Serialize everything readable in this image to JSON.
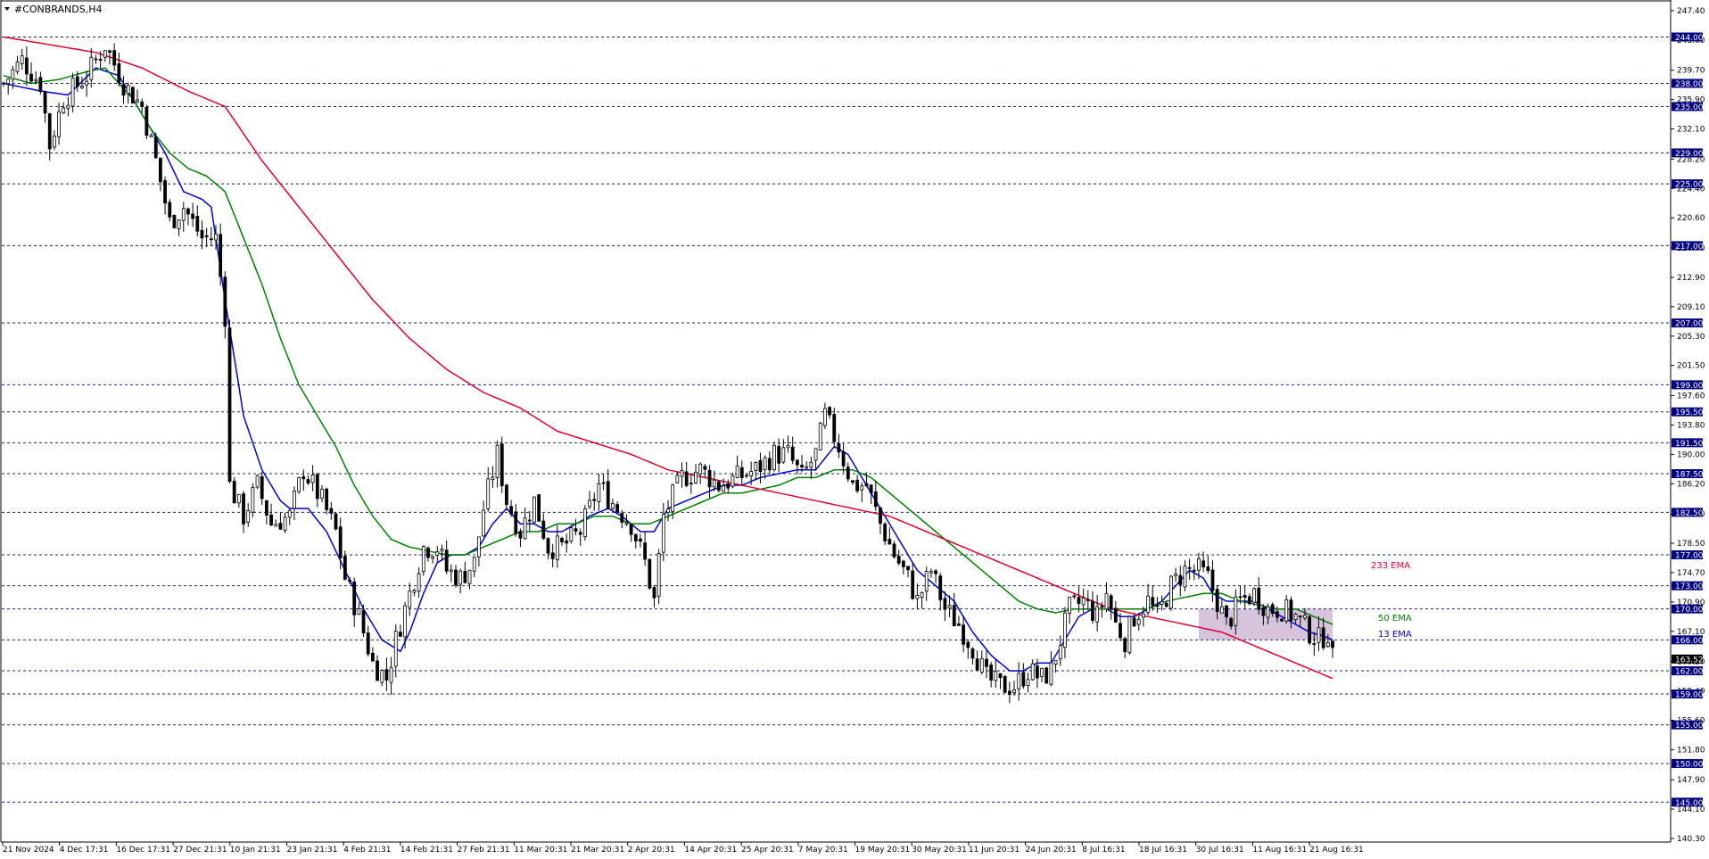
{
  "chart_data": {
    "type": "candlestick",
    "title": "#CONBRANDS,H4",
    "y_ticks": [
      "247.40",
      "243.60",
      "239.70",
      "235.90",
      "232.10",
      "228.20",
      "224.40",
      "220.60",
      "216.70",
      "212.90",
      "209.10",
      "205.30",
      "201.50",
      "197.60",
      "193.80",
      "190.00",
      "186.20",
      "182.30",
      "178.50",
      "174.70",
      "170.90",
      "167.10",
      "163.20",
      "159.40",
      "155.60",
      "151.80",
      "147.90",
      "144.10",
      "140.30"
    ],
    "ylim": [
      140.3,
      247.4
    ],
    "x_tick_labels": [
      "21 Nov 2024",
      "4 Dec 17:31",
      "16 Dec 17:31",
      "27 Dec 21:31",
      "10 Jan 21:31",
      "23 Jan 21:31",
      "4 Feb 21:31",
      "14 Feb 21:31",
      "27 Feb 21:31",
      "11 Mar 20:31",
      "21 Mar 20:31",
      "2 Apr 20:31",
      "14 Apr 20:31",
      "25 Apr 20:31",
      "7 May 20:31",
      "19 May 20:31",
      "30 May 20:31",
      "11 Jun 20:31",
      "24 Jun 20:31",
      "8 Jul 16:31",
      "18 Jul 16:31",
      "30 Jul 16:31",
      "11 Aug 16:31",
      "21 Aug 16:31"
    ],
    "horizontal_levels": [
      "244.00",
      "238.00",
      "235.00",
      "229.00",
      "225.00",
      "217.00",
      "207.00",
      "199.00",
      "195.50",
      "191.50",
      "187.50",
      "182.50",
      "177.00",
      "173.00",
      "170.00",
      "166.00",
      "162.00",
      "159.00",
      "155.00",
      "150.00",
      "145.00"
    ],
    "current_price": "163.52",
    "price_path": [
      [
        0,
        238
      ],
      [
        4,
        241
      ],
      [
        8,
        238
      ],
      [
        10,
        230
      ],
      [
        13,
        236
      ],
      [
        18,
        239
      ],
      [
        22,
        243
      ],
      [
        26,
        238
      ],
      [
        30,
        235
      ],
      [
        33,
        228
      ],
      [
        36,
        220
      ],
      [
        39,
        222
      ],
      [
        43,
        218
      ],
      [
        46,
        218
      ],
      [
        48,
        208
      ],
      [
        49,
        186
      ],
      [
        52,
        182
      ],
      [
        55,
        186
      ],
      [
        58,
        181
      ],
      [
        62,
        182
      ],
      [
        65,
        188
      ],
      [
        69,
        184
      ],
      [
        72,
        180
      ],
      [
        74,
        174
      ],
      [
        77,
        169
      ],
      [
        80,
        163
      ],
      [
        83,
        161
      ],
      [
        85,
        166
      ],
      [
        88,
        172
      ],
      [
        91,
        178
      ],
      [
        94,
        178
      ],
      [
        96,
        175
      ],
      [
        99,
        174
      ],
      [
        102,
        176
      ],
      [
        104,
        183
      ],
      [
        107,
        190
      ],
      [
        109,
        184
      ],
      [
        112,
        180
      ],
      [
        115,
        184
      ],
      [
        118,
        178
      ],
      [
        121,
        178
      ],
      [
        125,
        180
      ],
      [
        129,
        186
      ],
      [
        133,
        183
      ],
      [
        136,
        181
      ],
      [
        139,
        176
      ],
      [
        141,
        171
      ],
      [
        143,
        182
      ],
      [
        147,
        187
      ],
      [
        151,
        188
      ],
      [
        155,
        186
      ],
      [
        159,
        187
      ],
      [
        163,
        188
      ],
      [
        167,
        190
      ],
      [
        170,
        190
      ],
      [
        173,
        187
      ],
      [
        176,
        190
      ],
      [
        178,
        195
      ],
      [
        181,
        191
      ],
      [
        184,
        186
      ],
      [
        187,
        186
      ],
      [
        190,
        181
      ],
      [
        193,
        177
      ],
      [
        196,
        174
      ],
      [
        198,
        171
      ],
      [
        201,
        175
      ],
      [
        204,
        170
      ],
      [
        207,
        168
      ],
      [
        210,
        165
      ],
      [
        213,
        161
      ],
      [
        216,
        160
      ],
      [
        219,
        160
      ],
      [
        222,
        162
      ],
      [
        225,
        161
      ],
      [
        227,
        162
      ],
      [
        229,
        166
      ],
      [
        231,
        170
      ],
      [
        234,
        171
      ],
      [
        237,
        169
      ],
      [
        239,
        172
      ],
      [
        241,
        168
      ],
      [
        243,
        166
      ],
      [
        245,
        169
      ],
      [
        248,
        171
      ],
      [
        250,
        169
      ],
      [
        253,
        173
      ],
      [
        256,
        175
      ],
      [
        259,
        175
      ],
      [
        261,
        174
      ],
      [
        263,
        171
      ],
      [
        265,
        168
      ],
      [
        268,
        171
      ],
      [
        271,
        172
      ],
      [
        274,
        170
      ],
      [
        277,
        170
      ],
      [
        280,
        169
      ],
      [
        283,
        167
      ],
      [
        285,
        166
      ],
      [
        287,
        167
      ],
      [
        288,
        163.5
      ]
    ],
    "ema_values": [
      {
        "name": "13 EMA",
        "color": "#0000cc",
        "values": [
          [
            0,
            238
          ],
          [
            8,
            237
          ],
          [
            14,
            236.5
          ],
          [
            20,
            240
          ],
          [
            25,
            239
          ],
          [
            30,
            234
          ],
          [
            35,
            229
          ],
          [
            39,
            224
          ],
          [
            43,
            223
          ],
          [
            45,
            222
          ],
          [
            48,
            210
          ],
          [
            52,
            195
          ],
          [
            56,
            188
          ],
          [
            60,
            184
          ],
          [
            62,
            183
          ],
          [
            66,
            183
          ],
          [
            70,
            180
          ],
          [
            74,
            175
          ],
          [
            78,
            170
          ],
          [
            82,
            166
          ],
          [
            86,
            164.5
          ],
          [
            88,
            167
          ],
          [
            91,
            172
          ],
          [
            94,
            176
          ],
          [
            97,
            177
          ],
          [
            100,
            177
          ],
          [
            103,
            178
          ],
          [
            106,
            181
          ],
          [
            109,
            183
          ],
          [
            112,
            181
          ],
          [
            115,
            181
          ],
          [
            118,
            180
          ],
          [
            121,
            180
          ],
          [
            124,
            181
          ],
          [
            127,
            182
          ],
          [
            131,
            183
          ],
          [
            134,
            182
          ],
          [
            138,
            180
          ],
          [
            141,
            180
          ],
          [
            144,
            183
          ],
          [
            148,
            184
          ],
          [
            152,
            185
          ],
          [
            156,
            186
          ],
          [
            160,
            186
          ],
          [
            164,
            187
          ],
          [
            168,
            187.5
          ],
          [
            172,
            188
          ],
          [
            176,
            188
          ],
          [
            180,
            191
          ],
          [
            183,
            190
          ],
          [
            186,
            187
          ],
          [
            189,
            184
          ],
          [
            192,
            181
          ],
          [
            195,
            178
          ],
          [
            198,
            175
          ],
          [
            202,
            173
          ],
          [
            206,
            171
          ],
          [
            210,
            167
          ],
          [
            214,
            164
          ],
          [
            218,
            162
          ],
          [
            221,
            162
          ],
          [
            224,
            163
          ],
          [
            227,
            163
          ],
          [
            230,
            166
          ],
          [
            233,
            169
          ],
          [
            236,
            170
          ],
          [
            239,
            170
          ],
          [
            242,
            169
          ],
          [
            245,
            169
          ],
          [
            248,
            170
          ],
          [
            251,
            171
          ],
          [
            254,
            173
          ],
          [
            257,
            175
          ],
          [
            260,
            174
          ],
          [
            262,
            172
          ],
          [
            265,
            171
          ],
          [
            268,
            171
          ],
          [
            271,
            171
          ],
          [
            274,
            170
          ],
          [
            277,
            169
          ],
          [
            280,
            168
          ],
          [
            283,
            167
          ],
          [
            286,
            166.5
          ],
          [
            288,
            166
          ]
        ]
      },
      {
        "name": "50 EMA",
        "color": "#008000",
        "values": [
          [
            0,
            239
          ],
          [
            6,
            238
          ],
          [
            12,
            238.5
          ],
          [
            18,
            239.5
          ],
          [
            22,
            240
          ],
          [
            25,
            238
          ],
          [
            28,
            236
          ],
          [
            32,
            232
          ],
          [
            36,
            229
          ],
          [
            40,
            227
          ],
          [
            44,
            226
          ],
          [
            48,
            224
          ],
          [
            52,
            218
          ],
          [
            56,
            212
          ],
          [
            60,
            205
          ],
          [
            64,
            199
          ],
          [
            68,
            195
          ],
          [
            72,
            191
          ],
          [
            76,
            186
          ],
          [
            80,
            182
          ],
          [
            84,
            179
          ],
          [
            88,
            178
          ],
          [
            92,
            177.5
          ],
          [
            96,
            177
          ],
          [
            100,
            177
          ],
          [
            104,
            178
          ],
          [
            108,
            179
          ],
          [
            112,
            180
          ],
          [
            116,
            180
          ],
          [
            120,
            181
          ],
          [
            124,
            181
          ],
          [
            128,
            182
          ],
          [
            132,
            182
          ],
          [
            136,
            181
          ],
          [
            140,
            181
          ],
          [
            144,
            182
          ],
          [
            148,
            183
          ],
          [
            152,
            184
          ],
          [
            156,
            185
          ],
          [
            160,
            185
          ],
          [
            164,
            185.5
          ],
          [
            168,
            186
          ],
          [
            172,
            187
          ],
          [
            176,
            187
          ],
          [
            180,
            188
          ],
          [
            184,
            188
          ],
          [
            188,
            187
          ],
          [
            192,
            185
          ],
          [
            196,
            183
          ],
          [
            200,
            181
          ],
          [
            204,
            179
          ],
          [
            208,
            177
          ],
          [
            212,
            175
          ],
          [
            216,
            173
          ],
          [
            220,
            171
          ],
          [
            224,
            170
          ],
          [
            228,
            169.5
          ],
          [
            232,
            170
          ],
          [
            236,
            170
          ],
          [
            240,
            170
          ],
          [
            244,
            170
          ],
          [
            248,
            170
          ],
          [
            252,
            171
          ],
          [
            256,
            171.5
          ],
          [
            260,
            172
          ],
          [
            264,
            172
          ],
          [
            268,
            171
          ],
          [
            272,
            170.5
          ],
          [
            276,
            170
          ],
          [
            280,
            170
          ],
          [
            284,
            169
          ],
          [
            288,
            168
          ]
        ]
      },
      {
        "name": "233 EMA",
        "color": "#dd0033",
        "values": [
          [
            0,
            244
          ],
          [
            10,
            243
          ],
          [
            20,
            242
          ],
          [
            30,
            240
          ],
          [
            40,
            237
          ],
          [
            48,
            235
          ],
          [
            56,
            228
          ],
          [
            64,
            222
          ],
          [
            72,
            216
          ],
          [
            80,
            210
          ],
          [
            88,
            205
          ],
          [
            96,
            201
          ],
          [
            104,
            198
          ],
          [
            112,
            196
          ],
          [
            120,
            193
          ],
          [
            128,
            191.5
          ],
          [
            136,
            190
          ],
          [
            144,
            188
          ],
          [
            152,
            187
          ],
          [
            160,
            186
          ],
          [
            168,
            185
          ],
          [
            176,
            184
          ],
          [
            184,
            183
          ],
          [
            192,
            182
          ],
          [
            200,
            180
          ],
          [
            208,
            178
          ],
          [
            216,
            176
          ],
          [
            224,
            174
          ],
          [
            232,
            172
          ],
          [
            240,
            170
          ],
          [
            248,
            169
          ],
          [
            256,
            168
          ],
          [
            264,
            167
          ],
          [
            272,
            165
          ],
          [
            280,
            163
          ],
          [
            288,
            161
          ]
        ]
      }
    ],
    "ema_labels": [
      {
        "text": "233 EMA",
        "color": "#dd0033"
      },
      {
        "text": "50 EMA",
        "color": "#008000"
      },
      {
        "text": "13 EMA",
        "color": "#0000cc"
      }
    ],
    "highlight_zone": {
      "from_bar": 259,
      "to_bar": 288,
      "y_low": 166,
      "y_high": 170,
      "color": "#c8b0d0"
    }
  }
}
